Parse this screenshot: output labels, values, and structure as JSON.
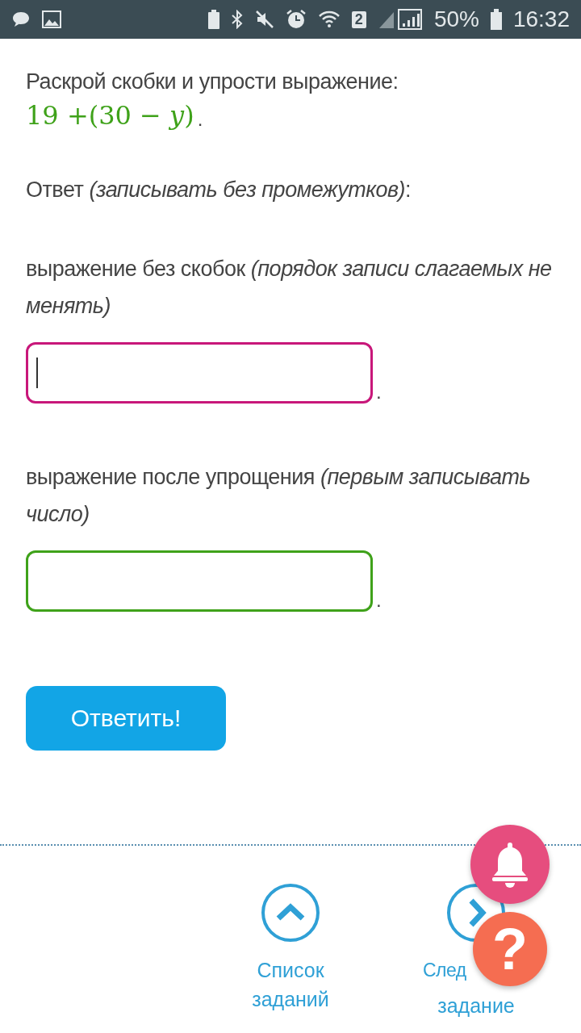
{
  "status_bar": {
    "sim_badge": "2",
    "battery": "50%",
    "time": "16:32"
  },
  "task": {
    "prompt": "Раскрой скобки и упрости выражение:",
    "expression": "19 +(30 − *y*)",
    "expression_end": "."
  },
  "answer_note": "Ответ *(записывать без промежутков)*:",
  "fields": [
    {
      "label": "выражение без скобок *(порядок записи слагаемых не менять)*",
      "color": "#c8177a",
      "focused": true,
      "suffix": "."
    },
    {
      "label": "выражение после упрощения *(первым записывать число)*",
      "color": "#3fa21a",
      "focused": false,
      "suffix": "."
    }
  ],
  "submit_button": "Ответить!",
  "nav": [
    {
      "kind": "up",
      "line1": "Список",
      "line2": "заданий"
    },
    {
      "kind": "next",
      "line1": "След",
      "line2": "задание"
    }
  ],
  "fab_help": "?"
}
